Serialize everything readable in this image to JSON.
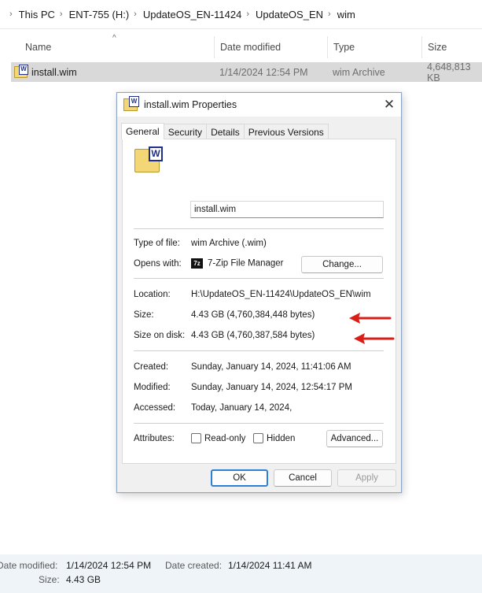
{
  "explorer": {
    "breadcrumb": [
      "This PC",
      "ENT-755 (H:)",
      "UpdateOS_EN-11424",
      "UpdateOS_EN",
      "wim"
    ],
    "columns": {
      "name": "Name",
      "date_modified": "Date modified",
      "type": "Type",
      "size": "Size"
    },
    "file": {
      "name": "install.wim",
      "date_modified": "1/14/2024 12:54 PM",
      "type": "wim Archive",
      "size": "4,648,813 KB"
    }
  },
  "dialog": {
    "title": "install.wim Properties",
    "tabs": [
      "General",
      "Security",
      "Details",
      "Previous Versions"
    ],
    "filename_value": "install.wim",
    "type_of_file_label": "Type of file:",
    "type_of_file_value": "wim Archive (.wim)",
    "opens_with_label": "Opens with:",
    "opens_with_icon_text": "7z",
    "opens_with_value": "7-Zip File Manager",
    "change_label": "Change...",
    "location_label": "Location:",
    "location_value": "H:\\UpdateOS_EN-11424\\UpdateOS_EN\\wim",
    "size_label": "Size:",
    "size_value": "4.43 GB (4,760,384,448 bytes)",
    "size_on_disk_label": "Size on disk:",
    "size_on_disk_value": "4.43 GB (4,760,387,584 bytes)",
    "created_label": "Created:",
    "created_value": "Sunday, January 14, 2024, 11:41:06 AM",
    "modified_label": "Modified:",
    "modified_value": "Sunday, January 14, 2024, 12:54:17 PM",
    "accessed_label": "Accessed:",
    "accessed_value": "Today, January 14, 2024,",
    "attributes_label": "Attributes:",
    "readonly_label": "Read-only",
    "hidden_label": "Hidden",
    "advanced_label": "Advanced...",
    "ok_label": "OK",
    "cancel_label": "Cancel",
    "apply_label": "Apply"
  },
  "details_pane": {
    "date_modified_label": "Date modified:",
    "date_modified_value": "1/14/2024 12:54 PM",
    "date_created_label": "Date created:",
    "date_created_value": "1/14/2024 11:41 AM",
    "size_label": "Size:",
    "size_value": "4.43 GB"
  },
  "colors": {
    "selection": "#d9d9d9",
    "annotation_arrow": "#d91e18",
    "ok_border": "#2f7fd6"
  }
}
